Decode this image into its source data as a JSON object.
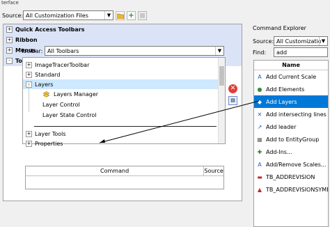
{
  "window_title": "terface",
  "source": {
    "label": "Source:",
    "value": "All Customization Files"
  },
  "tree_top": [
    {
      "label": "Quick Access Toolbars",
      "expander": "+"
    },
    {
      "label": "Ribbon",
      "expander": "+"
    },
    {
      "label": "Menus",
      "expander": "+"
    },
    {
      "label": "Toolbars",
      "expander": "-"
    }
  ],
  "toolbar_filter": {
    "label": "Toolbar:",
    "value": "All Toolbars"
  },
  "inner_tree": {
    "image_tracer": "ImageTracerToolbar",
    "standard": "Standard",
    "layers": "Layers",
    "layers_manager": "Layers Manager",
    "layer_control": "Layer Control",
    "layer_state_control": "Layer State Control",
    "layer_tools": "Layer Tools",
    "properties": "Properties",
    "expand": "+",
    "collapse": "-"
  },
  "command_table": {
    "col_command": "Command",
    "col_source": "Source"
  },
  "command_explorer": {
    "title": "Command Explorer",
    "source_label": "Source:",
    "source_value": "All Customization File",
    "find_label": "Find:",
    "find_value": "add",
    "column_name": "Name",
    "items": [
      {
        "label": "Add Current Scale",
        "icon": "scale-icon",
        "glyph": "A",
        "color": "#1a5fb4"
      },
      {
        "label": "Add Elements",
        "icon": "elements-icon",
        "glyph": "●",
        "color": "#3a8a3a"
      },
      {
        "label": "Add Layers",
        "icon": "layers-icon",
        "glyph": "◆",
        "color": "#ffffff"
      },
      {
        "label": "Add intersecting lines",
        "icon": "lines-icon",
        "glyph": "✕",
        "color": "#1a5fb4"
      },
      {
        "label": "Add leader",
        "icon": "leader-icon",
        "glyph": "↗",
        "color": "#1a5fb4"
      },
      {
        "label": "Add to EntityGroup",
        "icon": "group-icon",
        "glyph": "▦",
        "color": "#6a6a6a"
      },
      {
        "label": "Add-Ins...",
        "icon": "addins-icon",
        "glyph": "✚",
        "color": "#2e7d32"
      },
      {
        "label": "Add/Remove Scales...",
        "icon": "scales-icon",
        "glyph": "A",
        "color": "#1a5fb4"
      },
      {
        "label": "TB_ADDREVISION",
        "icon": "revision-icon",
        "glyph": "▬",
        "color": "#c62828"
      },
      {
        "label": "TB_ADDREVISIONSYMBOL",
        "icon": "revision-symbol-icon",
        "glyph": "▲",
        "color": "#c62828"
      }
    ]
  }
}
